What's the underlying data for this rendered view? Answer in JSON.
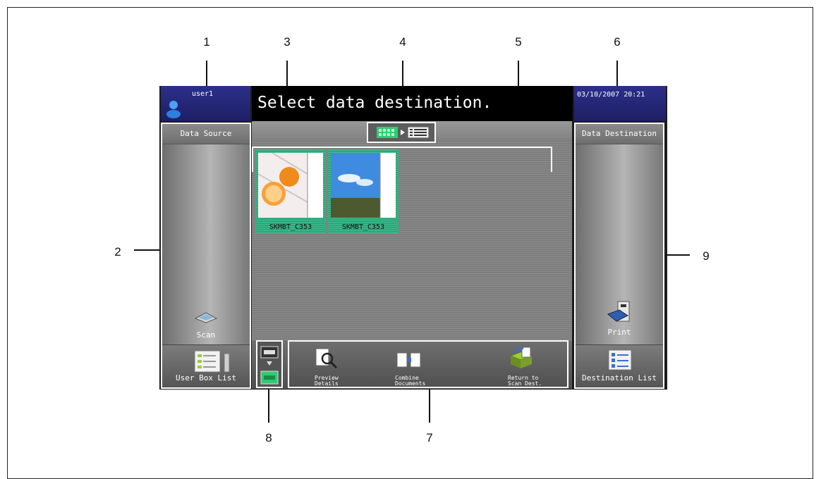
{
  "callouts": [
    "1",
    "2",
    "3",
    "4",
    "5",
    "6",
    "7",
    "8",
    "9"
  ],
  "header": {
    "user": "user1",
    "message": "Select data destination.",
    "datetime": "03/10/2007 20:21"
  },
  "left_panel": {
    "title": "Data Source",
    "scan_label": "Scan",
    "user_box_list_label": "User Box List"
  },
  "right_panel": {
    "title": "Data Destination",
    "print_label": "Print",
    "destination_list_label": "Destination List"
  },
  "thumbnails": [
    {
      "name": "SKMBT_C353",
      "icon": "orange-photo-icon"
    },
    {
      "name": "SKMBT_C353",
      "icon": "sky-photo-icon"
    }
  ],
  "toolbar": {
    "preview_details_label": "Preview\nDetails",
    "combine_documents_label": "Combine\nDocuments",
    "return_to_scan_label": "Return to\nScan Dest."
  },
  "colors": {
    "header_blue": "#2c2f8a",
    "thumb_selected": "#3fbf8f"
  }
}
